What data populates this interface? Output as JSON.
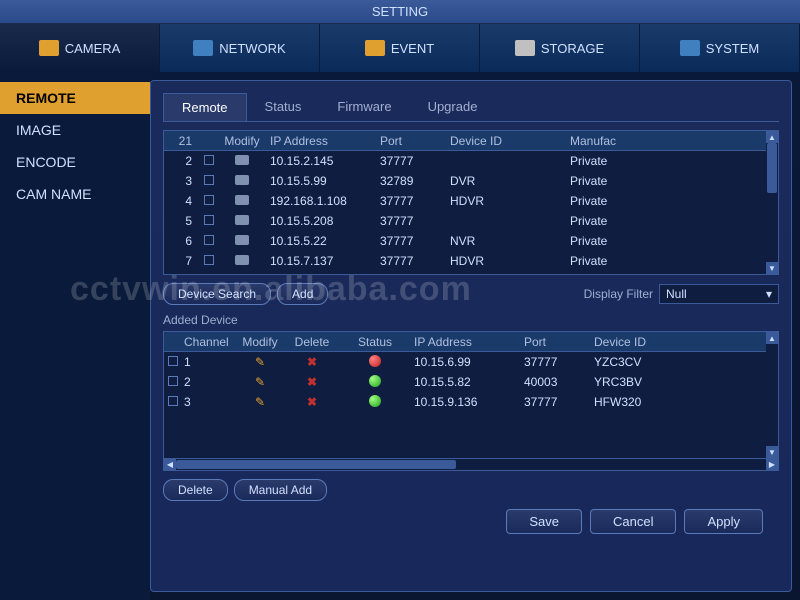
{
  "title": "SETTING",
  "toptabs": [
    "CAMERA",
    "NETWORK",
    "EVENT",
    "STORAGE",
    "SYSTEM"
  ],
  "sidebar": [
    "REMOTE",
    "IMAGE",
    "ENCODE",
    "CAM NAME"
  ],
  "subtabs": [
    "Remote",
    "Status",
    "Firmware",
    "Upgrade"
  ],
  "search_table": {
    "header_count": "21",
    "headers": [
      "Modify",
      "IP Address",
      "Port",
      "Device ID",
      "Manufac"
    ],
    "rows": [
      {
        "idx": "2",
        "ip": "10.15.2.145",
        "port": "37777",
        "dev": "",
        "man": "Private"
      },
      {
        "idx": "3",
        "ip": "10.15.5.99",
        "port": "32789",
        "dev": "DVR",
        "man": "Private"
      },
      {
        "idx": "4",
        "ip": "192.168.1.108",
        "port": "37777",
        "dev": "HDVR",
        "man": "Private"
      },
      {
        "idx": "5",
        "ip": "10.15.5.208",
        "port": "37777",
        "dev": "",
        "man": "Private"
      },
      {
        "idx": "6",
        "ip": "10.15.5.22",
        "port": "37777",
        "dev": "NVR",
        "man": "Private"
      },
      {
        "idx": "7",
        "ip": "10.15.7.137",
        "port": "37777",
        "dev": "HDVR",
        "man": "Private"
      }
    ]
  },
  "buttons": {
    "device_search": "Device Search",
    "add": "Add",
    "delete": "Delete",
    "manual_add": "Manual Add",
    "save": "Save",
    "cancel": "Cancel",
    "apply": "Apply"
  },
  "display_filter_label": "Display Filter",
  "display_filter_value": "Null",
  "added_device_label": "Added Device",
  "added_table": {
    "headers": [
      "Channel",
      "Modify",
      "Delete",
      "Status",
      "IP Address",
      "Port",
      "Device ID"
    ],
    "rows": [
      {
        "ch": "1",
        "status": "red",
        "ip": "10.15.6.99",
        "port": "37777",
        "dev": "YZC3CV"
      },
      {
        "ch": "2",
        "status": "green",
        "ip": "10.15.5.82",
        "port": "40003",
        "dev": "YRC3BV"
      },
      {
        "ch": "3",
        "status": "green",
        "ip": "10.15.9.136",
        "port": "37777",
        "dev": "HFW320"
      }
    ]
  },
  "watermark": "cctvwin.en.alibaba.com"
}
